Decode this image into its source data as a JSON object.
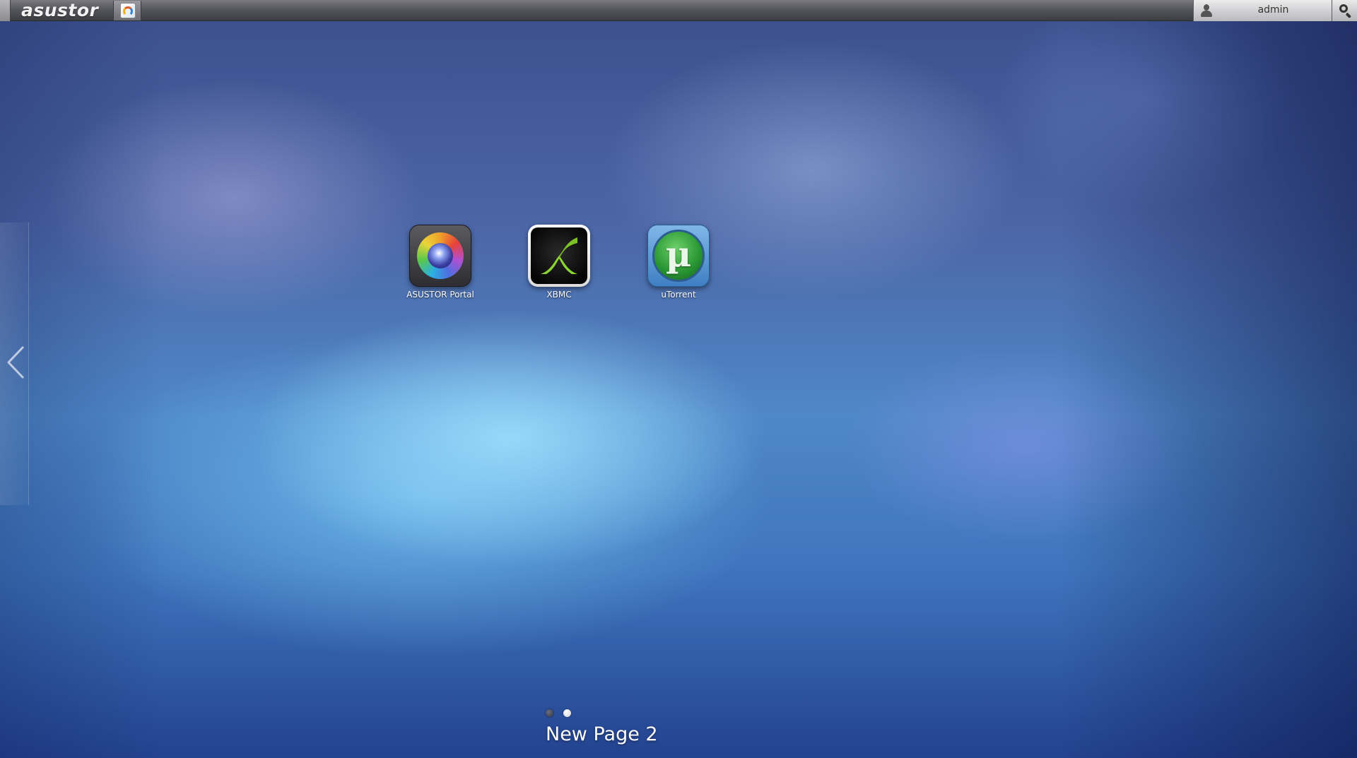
{
  "topbar": {
    "brand": "asustor",
    "user": "admin"
  },
  "icons": {
    "launcher": "launcher-icon",
    "user": "user-icon",
    "search": "search-icon",
    "prev": "chevron-left-icon"
  },
  "apps": [
    {
      "label": "ASUSTOR Portal",
      "icon": "asustor-portal-icon"
    },
    {
      "label": "XBMC",
      "icon": "xbmc-icon"
    },
    {
      "label": "uTorrent",
      "icon": "utorrent-icon"
    }
  ],
  "pagination": {
    "total": 2,
    "active": 2,
    "page_name": "New Page 2"
  },
  "colors": {
    "topbar": "#4a4b51",
    "accent_green": "#8bd431"
  }
}
